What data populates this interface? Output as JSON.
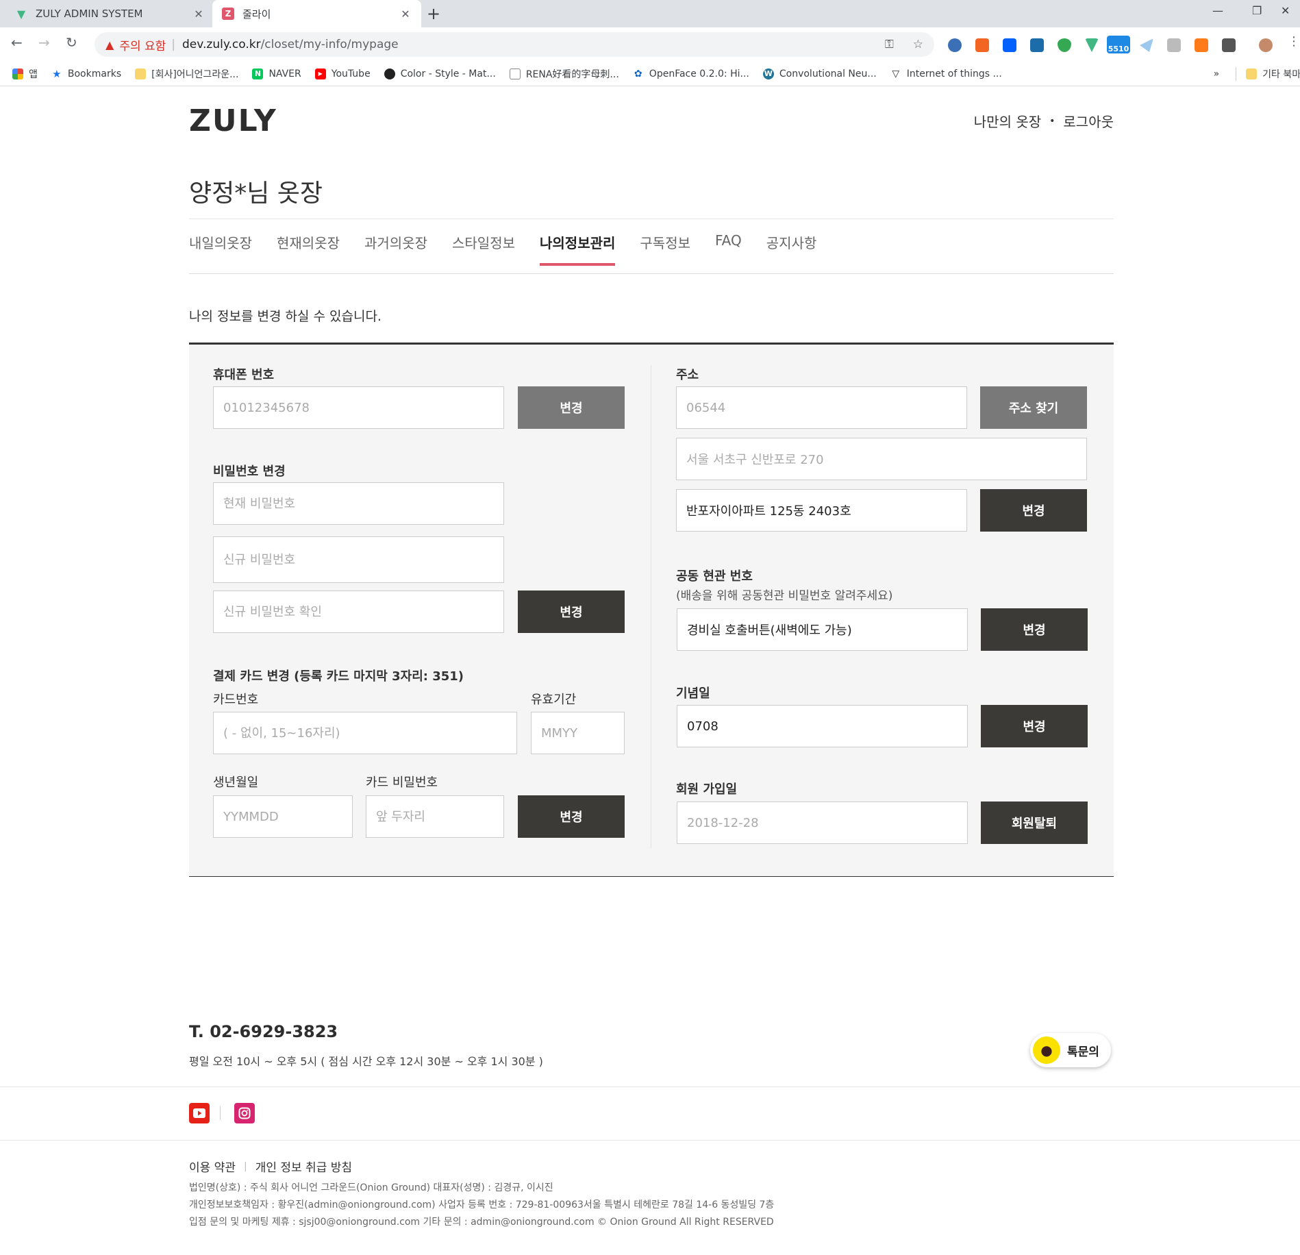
{
  "browser": {
    "tabs": [
      {
        "title": "ZULY ADMIN SYSTEM"
      },
      {
        "title": "줄라이"
      }
    ],
    "address": {
      "warning": "주의 요함",
      "host": "dev.zuly.co.kr",
      "path": "/closet/my-info/mypage"
    },
    "bookmarks": [
      {
        "label": "앱"
      },
      {
        "label": "Bookmarks"
      },
      {
        "label": "[회사]어니언그라운..."
      },
      {
        "label": "NAVER"
      },
      {
        "label": "YouTube"
      },
      {
        "label": "Color - Style - Mat..."
      },
      {
        "label": "RENA好看的字母刺..."
      },
      {
        "label": "OpenFace 0.2.0: Hi..."
      },
      {
        "label": "Convolutional Neu..."
      },
      {
        "label": "Internet of things ..."
      }
    ],
    "bookmarks_more": "»",
    "bookmarks_other": "기타 북마크",
    "ext_badge": "5510"
  },
  "header": {
    "logo": "ZULY",
    "nav_closet": "나만의 옷장",
    "nav_logout": "로그아웃"
  },
  "page_title": "양정*님 옷장",
  "tabs": [
    {
      "label": "내일의옷장"
    },
    {
      "label": "현재의옷장"
    },
    {
      "label": "과거의옷장"
    },
    {
      "label": "스타일정보"
    },
    {
      "label": "나의정보관리"
    },
    {
      "label": "구독정보"
    },
    {
      "label": "FAQ"
    },
    {
      "label": "공지사항"
    }
  ],
  "active_tab": "나의정보관리",
  "description": "나의 정보를 변경 하실 수 있습니다.",
  "left": {
    "phone": {
      "label": "휴대폰 번호",
      "value": "01012345678",
      "button": "변경"
    },
    "password": {
      "label": "비밀번호 변경",
      "current_placeholder": "현재 비밀번호",
      "new_placeholder": "신규 비밀번호",
      "confirm_placeholder": "신규 비밀번호 확인",
      "button": "변경"
    },
    "card": {
      "label": "결제 카드 변경 (등록 카드 마지막 3자리: 351)",
      "number_label": "카드번호",
      "number_placeholder": "( - 없이, 15~16자리)",
      "expiry_label": "유효기간",
      "expiry_placeholder": "MMYY",
      "birth_label": "생년월일",
      "birth_placeholder": "YYMMDD",
      "pw_label": "카드 비밀번호",
      "pw_placeholder": "앞 두자리",
      "button": "변경"
    }
  },
  "right": {
    "address": {
      "label": "주소",
      "zipcode": "06544",
      "search_button": "주소 찾기",
      "address1": "서울 서초구 신반포로 270",
      "address2": "반포자이아파트 125동 2403호",
      "button": "변경"
    },
    "entrance": {
      "label": "공동 현관 번호",
      "sub": "(배송을 위해 공동현관 비밀번호 알려주세요)",
      "value": "경비실 호출버튼(새벽에도 가능)",
      "button": "변경"
    },
    "anniversary": {
      "label": "기념일",
      "value": "0708",
      "button": "변경"
    },
    "joined": {
      "label": "회원 가입일",
      "value": "2018-12-28",
      "button": "회원탈퇴"
    }
  },
  "footer": {
    "phone": "T. 02-6929-3823",
    "hours": "평일 오전 10시 ~ 오후 5시 ( 점심 시간 오후 12시 30분 ~ 오후 1시 30분 )",
    "kakao": "톡문의",
    "terms": "이용 약관",
    "privacy": "개인 정보 취급 방침",
    "info_lines": [
      "법인명(상호) : 주식 회사 어니언 그라운드(Onion Ground) 대표자(성명) : 김경규, 이시진",
      "개인정보보호책임자 : 황우진(admin@onionground.com) 사업자 등록 번호 : 729-81-00963서울 특별시 테헤란로 78길 14-6 동성빌딩 7층",
      "입점 문의 및 마케팅 제휴 : sjsj00@onionground.com 기타 문의 : admin@onionground.com © Onion Ground All Right RESERVED"
    ]
  },
  "colors": {
    "accent": "#e0566b",
    "dark_button": "#3b3a36",
    "grey_button": "#797979",
    "kakao": "#fae100"
  }
}
